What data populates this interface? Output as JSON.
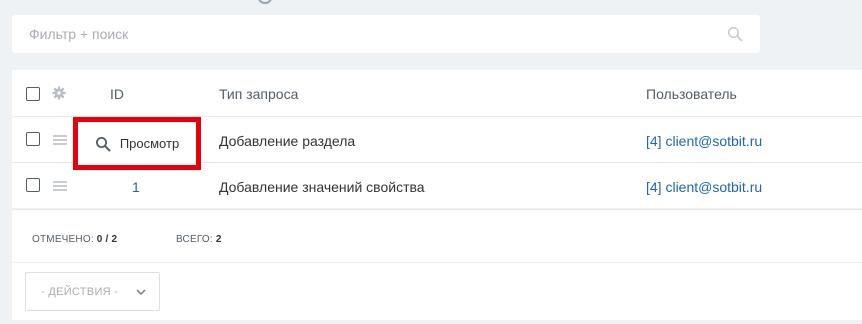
{
  "filter": {
    "placeholder": "Фильтр + поиск",
    "icon": "search-icon"
  },
  "grid": {
    "columns": {
      "id": "ID",
      "type": "Тип запроса",
      "user": "Пользователь"
    },
    "rows": [
      {
        "id": "",
        "view_label": "Просмотр",
        "type": "Добавление раздела",
        "user": "[4] client@sotbit.ru"
      },
      {
        "id": "1",
        "type": "Добавление значений свойства",
        "user": "[4] client@sotbit.ru"
      }
    ]
  },
  "footer": {
    "checked_label": "ОТМЕЧЕНО:",
    "checked_value": "0 / 2",
    "total_label": "ВСЕГО:",
    "total_value": "2"
  },
  "actions": {
    "select_label": "- ДЕЙСТВИЯ -"
  },
  "colors": {
    "link": "#2067b0",
    "highlight": "#e8000b",
    "background": "#eef2f4"
  }
}
